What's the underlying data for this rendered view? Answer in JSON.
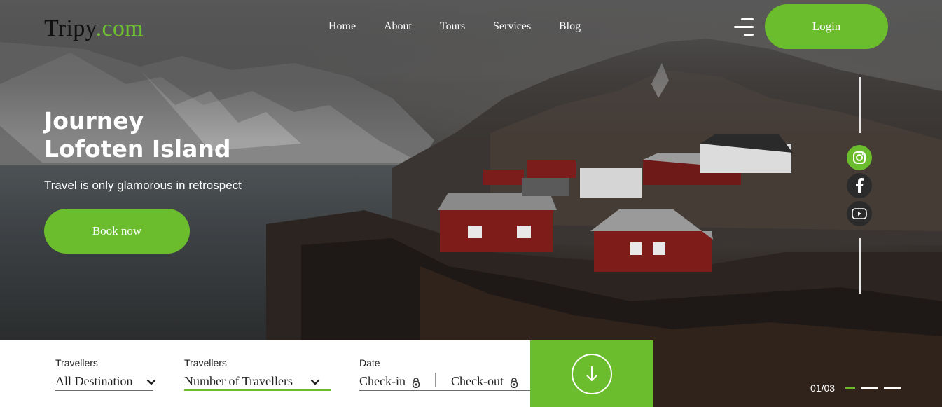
{
  "brand": {
    "name": "Tripy",
    "suffix": ".com",
    "accent_color": "#6cbd2d"
  },
  "nav": {
    "items": [
      {
        "label": "Home"
      },
      {
        "label": "About"
      },
      {
        "label": "Tours"
      },
      {
        "label": "Services"
      },
      {
        "label": "Blog"
      }
    ],
    "login_label": "Login"
  },
  "hero": {
    "title_line1": "Journey",
    "title_line2": "Lofoten Island",
    "subtitle": "Travel is only glamorous in retrospect",
    "cta_label": "Book now"
  },
  "social": [
    {
      "icon": "instagram-icon"
    },
    {
      "icon": "facebook-icon"
    },
    {
      "icon": "youtube-icon"
    }
  ],
  "search": {
    "destination": {
      "label": "Travellers",
      "value": "All Destination"
    },
    "travellers": {
      "label": "Travellers",
      "value": "Number of Travellers"
    },
    "date": {
      "label": "Date",
      "checkin": "Check-in",
      "checkout": "Check-out"
    },
    "submit_icon": "arrow-down-icon"
  },
  "slider": {
    "indicator": "01/03"
  }
}
